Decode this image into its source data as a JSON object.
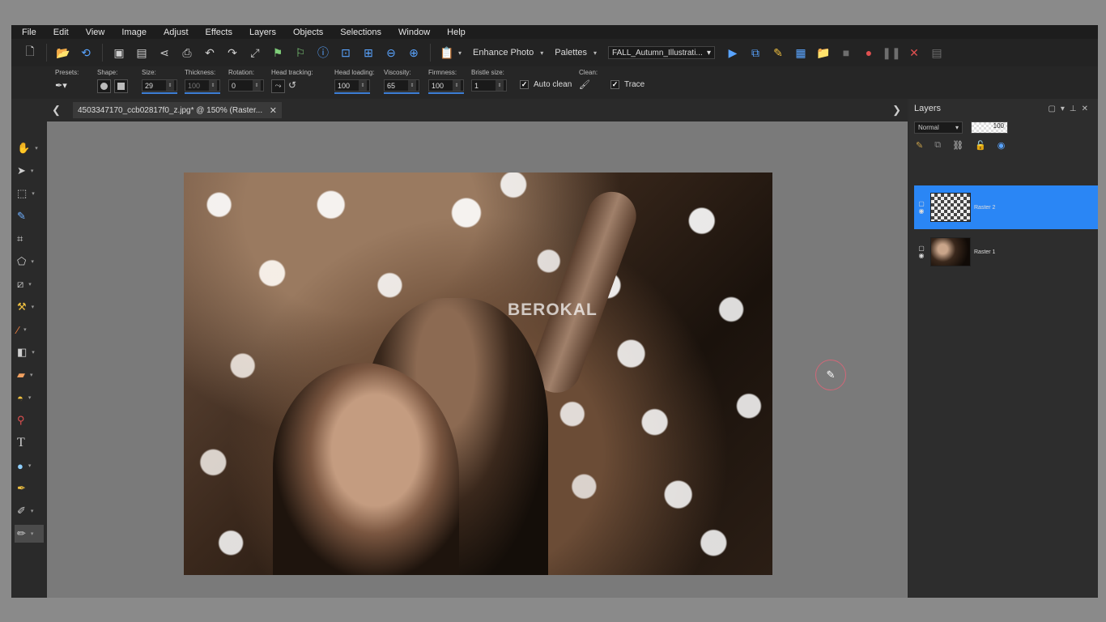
{
  "menu": [
    "File",
    "Edit",
    "View",
    "Image",
    "Adjust",
    "Effects",
    "Layers",
    "Objects",
    "Selections",
    "Window",
    "Help"
  ],
  "toolbar": {
    "enhance_photo": "Enhance Photo",
    "palettes": "Palettes",
    "workspace_name": "FALL_Autumn_Illustrati..."
  },
  "tool_options": {
    "presets_label": "Presets:",
    "shape_label": "Shape:",
    "size_label": "Size:",
    "size_value": "29",
    "thickness_label": "Thickness:",
    "thickness_value": "100",
    "rotation_label": "Rotation:",
    "rotation_value": "0",
    "head_tracking_label": "Head tracking:",
    "head_loading_label": "Head loading:",
    "head_loading_value": "100",
    "viscosity_label": "Viscosity:",
    "viscosity_value": "65",
    "firmness_label": "Firmness:",
    "firmness_value": "100",
    "bristle_size_label": "Bristle size:",
    "bristle_size_value": "1",
    "clean_label": "Clean:",
    "auto_clean_label": "Auto clean",
    "auto_clean_checked": true,
    "trace_label": "Trace",
    "trace_checked": true
  },
  "document_tab": {
    "title": "4503347170_ccb02817f0_z.jpg* @ 150% (Raster..."
  },
  "canvas": {
    "watermark": "BEROKAL"
  },
  "layers_panel": {
    "title": "Layers",
    "blend_mode": "Normal",
    "opacity": "100",
    "layers": [
      {
        "name": "Raster 2",
        "selected": true
      },
      {
        "name": "Raster 1",
        "selected": false
      }
    ]
  },
  "colors": {
    "accent": "#2a86f5",
    "app_bg": "#2c2c2c",
    "canvas_bg": "#7a7a7a"
  }
}
